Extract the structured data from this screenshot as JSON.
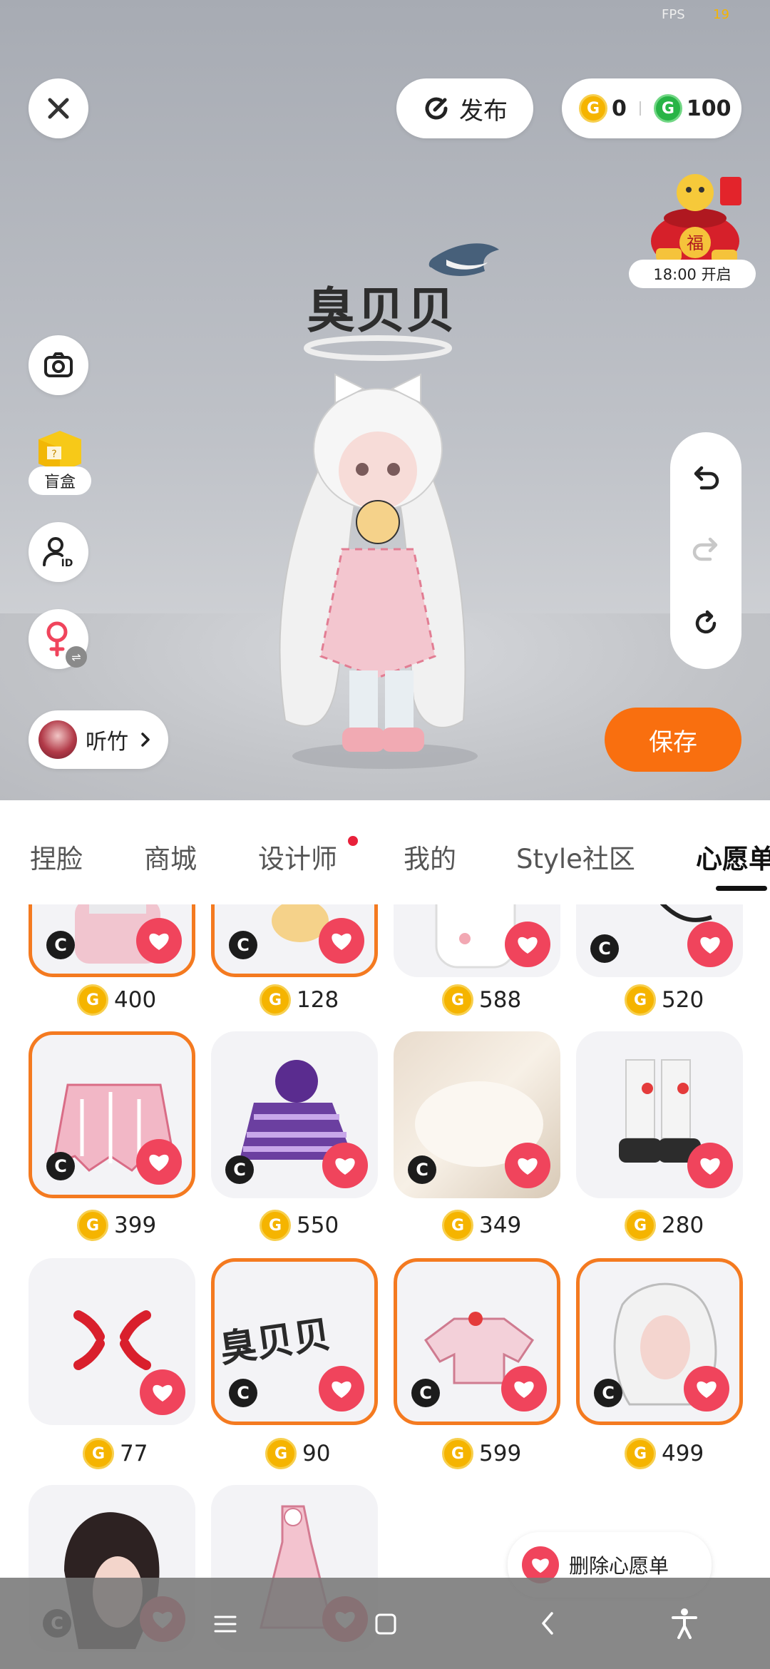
{
  "status": {
    "fps_label": "FPS",
    "fps_value": "19"
  },
  "top": {
    "publish_label": "发布",
    "gold_coins": "0",
    "green_coins": "100",
    "event_time": "18:00 开启"
  },
  "left_tools": {
    "blindbox_label": "盲盒",
    "user_name": "听竹"
  },
  "stage": {
    "name_tag": "臭贝贝",
    "save_label": "保存"
  },
  "tabs": [
    "捏脸",
    "商城",
    "设计师",
    "我的",
    "Style社区",
    "心愿单"
  ],
  "items": [
    {
      "price": "400",
      "selected": true
    },
    {
      "price": "128",
      "selected": true
    },
    {
      "price": "588",
      "selected": false
    },
    {
      "price": "520",
      "selected": false
    },
    {
      "price": "399",
      "selected": true
    },
    {
      "price": "550",
      "selected": false
    },
    {
      "price": "349",
      "selected": false
    },
    {
      "price": "280",
      "selected": false
    },
    {
      "price": "77",
      "selected": false
    },
    {
      "price": "90",
      "selected": true
    },
    {
      "price": "599",
      "selected": true
    },
    {
      "price": "499",
      "selected": true
    }
  ],
  "item_text": {
    "currency_badge": "C",
    "card_name_tag": "臭贝贝"
  },
  "delete_wishlist_label": "删除心愿单",
  "colors": {
    "accent": "#f96f0f",
    "heart": "#f0445c",
    "gold": "#f5b400",
    "green": "#28b446"
  }
}
